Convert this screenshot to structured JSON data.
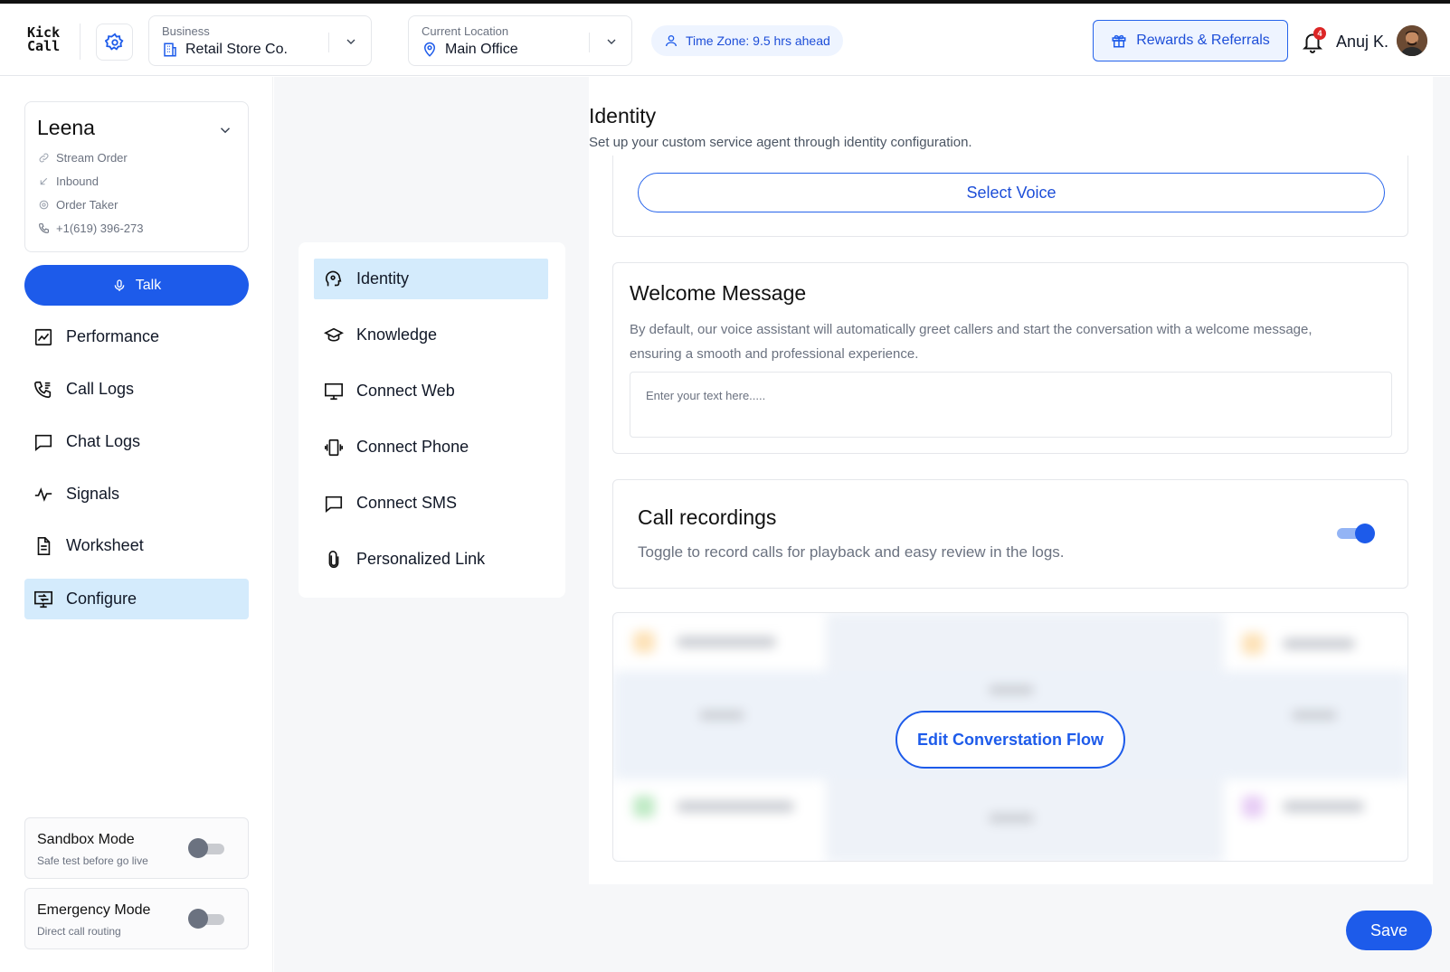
{
  "app": {
    "logo_line1": "Kick",
    "logo_line2": "Call"
  },
  "header": {
    "business_label": "Business",
    "business_value": "Retail Store Co.",
    "location_label": "Current Location",
    "location_value": "Main Office",
    "timezone": "Time Zone: 9.5 hrs ahead",
    "rewards_label": "Rewards & Referrals",
    "notification_count": "4",
    "user_name": "Anuj K."
  },
  "agent": {
    "name": "Leena",
    "details": [
      {
        "icon": "link-icon",
        "text": "Stream Order"
      },
      {
        "icon": "arrow-inbound-icon",
        "text": "Inbound"
      },
      {
        "icon": "gear-icon",
        "text": "Order Taker"
      },
      {
        "icon": "phone-icon",
        "text": "+1(619) 396-273"
      }
    ],
    "talk_label": "Talk"
  },
  "sidebar": {
    "items": [
      {
        "label": "Performance",
        "icon": "chart-icon"
      },
      {
        "label": "Call Logs",
        "icon": "call-logs-icon"
      },
      {
        "label": "Chat Logs",
        "icon": "chat-icon"
      },
      {
        "label": "Signals",
        "icon": "pulse-icon"
      },
      {
        "label": "Worksheet",
        "icon": "document-icon"
      },
      {
        "label": "Configure",
        "icon": "configure-icon",
        "active": true
      }
    ],
    "sandbox": {
      "title": "Sandbox Mode",
      "subtitle": "Safe test before go live",
      "enabled": false
    },
    "emergency": {
      "title": "Emergency Mode",
      "subtitle": "Direct call routing",
      "enabled": false
    }
  },
  "config_menu": {
    "items": [
      {
        "label": "Identity",
        "icon": "identity-head-icon",
        "active": true
      },
      {
        "label": "Knowledge",
        "icon": "graduation-cap-icon"
      },
      {
        "label": "Connect Web",
        "icon": "monitor-icon"
      },
      {
        "label": "Connect Phone",
        "icon": "phone-vibrate-icon"
      },
      {
        "label": "Connect SMS",
        "icon": "message-square-icon"
      },
      {
        "label": "Personalized Link",
        "icon": "paperclip-icon"
      }
    ]
  },
  "identity": {
    "title": "Identity",
    "subtitle": "Set up your custom service agent through identity configuration.",
    "select_voice_label": "Select Voice",
    "welcome": {
      "title": "Welcome Message",
      "description": "By default, our voice assistant will automatically greet callers and start the conversation with a welcome message, ensuring a smooth and professional experience.",
      "placeholder": "Enter your text here.....",
      "value": ""
    },
    "recordings": {
      "title": "Call recordings",
      "description": "Toggle to record calls for playback and easy review in the logs.",
      "enabled": true
    },
    "flow_button_label": "Edit Converstation Flow",
    "save_label": "Save"
  },
  "colors": {
    "primary": "#1d5bea",
    "active_bg": "#d4ebfc",
    "badge": "#dc2626"
  }
}
